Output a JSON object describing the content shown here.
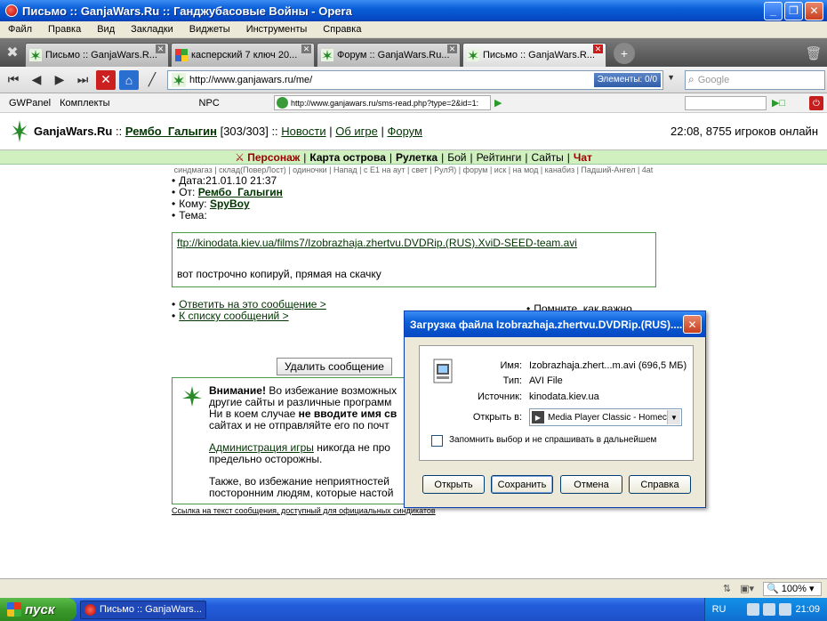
{
  "window": {
    "title": "Письмо :: GanjaWars.Ru :: Ганджубасовые Войны - Opera"
  },
  "menu": [
    "Файл",
    "Правка",
    "Вид",
    "Закладки",
    "Виджеты",
    "Инструменты",
    "Справка"
  ],
  "tabs": [
    {
      "label": "Письмо :: GanjaWars.R..."
    },
    {
      "label": "касперский 7 ключ 20..."
    },
    {
      "label": "Форум :: GanjaWars.Ru..."
    },
    {
      "label": "Письмо :: GanjaWars.R..."
    }
  ],
  "address": {
    "url": "http://www.ganjawars.ru/me/",
    "elements": "Элементы:  0/0",
    "search_placeholder": "Google"
  },
  "panel": {
    "items": [
      "GWPanel",
      "Комплекты",
      "NPC"
    ],
    "url": "http://www.ganjawars.ru/sms-read.php?type=2&id=1:"
  },
  "header": {
    "site": "GanjaWars.Ru",
    "sep1": "::",
    "nick": "Рембо_Галыгин",
    "hp": "[303/303]",
    "sep2": "::",
    "links": [
      "Новости",
      "Об игре",
      "Форум"
    ],
    "status": "22:08, 8755 игроков онлайн"
  },
  "nav": [
    "Персонаж",
    "Карта острова",
    "Рулетка",
    "Бой",
    "Рейтинги",
    "Сайты",
    "Чат"
  ],
  "subnav": "синдмагаз | склад(ПоверЛост) | одиночки | Напад | с Е1 на аут | свет | РулЯ) | форум | иск | на мод | канабиз | Падший-Ангел | 4at",
  "message": {
    "date_label": "Дата:",
    "date": "21.01.10 21:37",
    "from_label": "От:",
    "from": "Рембо_Галыгин",
    "to_label": "Кому:",
    "to": "SpyBoy",
    "subject_label": "Тема:",
    "link": "ftp://kinodata.kiev.ua/films7/Izobrazhaja.zhertvu.DVDRip.(RUS).XviD-SEED-team.avi",
    "body": "вот построчно копируй, прямая на скачку"
  },
  "actions": {
    "reply": "Ответить на это сообщение >",
    "list": "К списку сообщений >",
    "side_hint": "Помните, как важно",
    "delete": "Удалить сообщение"
  },
  "warning": {
    "p1_bold": "Внимание!",
    "p1_a": " Во избежание возможных",
    "p1_b": "другие сайты и различные программ",
    "p1_c_pre": "Ни в коем случае ",
    "p1_c_bold": "не вводите имя св",
    "p1_d": "сайтах и не отправляйте его по почт",
    "p2_link": "Администрация игры",
    "p2_a": " никогда не про",
    "p2_b": "предельно осторожны.",
    "p3_a": "Также, во избежание неприятностей",
    "p3_b": "посторонним людям, которые настой",
    "footer": "Ссылка на текст сообщения, доступный для официальных синдикатов"
  },
  "dialog": {
    "title": "Загрузка файла Izobrazhaja.zhertvu.DVDRip.(RUS)....",
    "name_label": "Имя:",
    "name": "Izobrazhaja.zhert...m.avi (696,5 МБ)",
    "type_label": "Тип:",
    "type": "AVI File",
    "source_label": "Источник:",
    "source": "kinodata.kiev.ua",
    "open_label": "Открыть в:",
    "open_app": "Media Player Classic - Homecine",
    "remember": "Запомнить выбор и не спрашивать в дальнейшем",
    "buttons": [
      "Открыть",
      "Сохранить",
      "Отмена",
      "Справка"
    ]
  },
  "status": {
    "zoom": "100%"
  },
  "taskbar": {
    "start": "пуск",
    "item": "Письмо :: GanjaWars...",
    "lang": "RU",
    "clock": "21:09"
  }
}
